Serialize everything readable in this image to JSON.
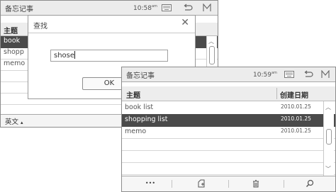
{
  "back_window": {
    "title": "备忘记事",
    "clock": "10:58",
    "clock_suffix": "am",
    "column_header": "主题",
    "rows": [
      "book",
      "shopp",
      "memo"
    ],
    "input_method": "英文",
    "input_method_arrow": "▴"
  },
  "find_dialog": {
    "title": "查找",
    "close_symbol": "✕",
    "query": "shose",
    "ok_label": "OK"
  },
  "front_window": {
    "title": "备忘记事",
    "clock": "10:59",
    "clock_suffix": "am",
    "header_subject": "主题",
    "header_date": "创建日期",
    "rows": [
      {
        "subject": "book list",
        "date": "2010.01.25"
      },
      {
        "subject": "shopping list",
        "date": "2010.01.25",
        "selected": true
      },
      {
        "subject": "memo",
        "date": "2010.01.25"
      }
    ],
    "toolbar": {
      "more": "•••",
      "new": "⌂",
      "delete": "⌫",
      "search": "⌕"
    }
  },
  "titlebar_icons": [
    "keyboard-icon",
    "back-icon",
    "menu-icon"
  ]
}
